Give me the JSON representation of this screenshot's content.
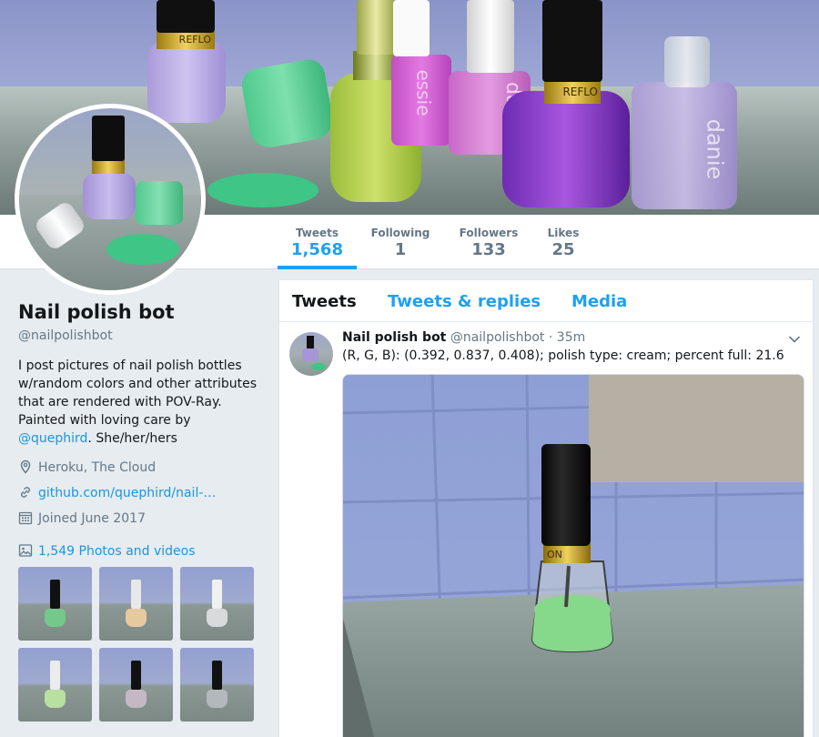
{
  "profile": {
    "name": "Nail polish bot",
    "handle": "@nailpolishbot",
    "bio_prefix": "I post pictures of nail polish bottles w/random colors and other attributes that are rendered with POV-Ray. Painted with loving care by",
    "bio_link": "@quephird",
    "bio_suffix": ". She/her/hers",
    "location": "Heroku, The Cloud",
    "website": "github.com/quephird/nail-…",
    "joined": "Joined June 2017",
    "media_count_label": "1,549 Photos and videos"
  },
  "stats": [
    {
      "label": "Tweets",
      "value": "1,568",
      "active": true
    },
    {
      "label": "Following",
      "value": "1",
      "active": false
    },
    {
      "label": "Followers",
      "value": "133",
      "active": false
    },
    {
      "label": "Likes",
      "value": "25",
      "active": false
    }
  ],
  "tabs": [
    {
      "label": "Tweets",
      "active": true
    },
    {
      "label": "Tweets & replies",
      "active": false
    },
    {
      "label": "Media",
      "active": false
    }
  ],
  "tweet": {
    "author": "Nail polish bot",
    "handle": "@nailpolishbot",
    "separator": "·",
    "time": "35m",
    "text": "(R, G, B): (0.392, 0.837, 0.408); polish type: cream; percent full: 21.6"
  },
  "banner_labels": {
    "revlon_1": "REFLO",
    "revlon_2": "REFLO",
    "essie_1": "essie",
    "essie_2": "danie",
    "essie_3": "danie"
  },
  "media_label": "ON",
  "thumb_colors": [
    "#74c98a",
    "#e7c9a0",
    "#d8dadc",
    "#b8e0a0",
    "#c6b7c4",
    "#b3b8bd"
  ],
  "colors": {
    "accent": "#1da1f2",
    "link": "#1b95e0",
    "muted": "#657786"
  },
  "icons": [
    "location-icon",
    "link-icon",
    "calendar-icon",
    "photo-icon",
    "chevron-down-icon"
  ]
}
